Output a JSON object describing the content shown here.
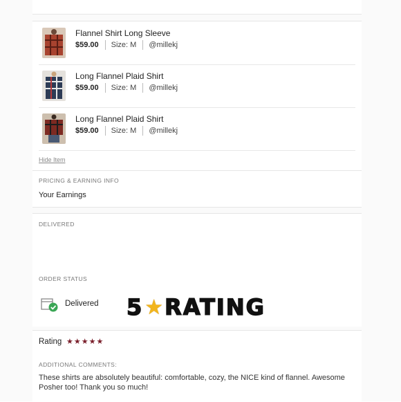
{
  "items": [
    {
      "title": "Flannel Shirt Long Sleeve",
      "price": "$59.00",
      "size": "Size: M",
      "seller": "@millekj",
      "thumb_icon": "shirt-photo"
    },
    {
      "title": "Long Flannel Plaid Shirt",
      "price": "$59.00",
      "size": "Size: M",
      "seller": "@millekj",
      "thumb_icon": "shirt-photo"
    },
    {
      "title": "Long Flannel Plaid Shirt",
      "price": "$59.00",
      "size": "Size: M",
      "seller": "@millekj",
      "thumb_icon": "shirt-photo"
    }
  ],
  "hide_item_label": "Hide Item",
  "pricing": {
    "section_label": "PRICING & EARNING INFO",
    "earnings_label": "Your Earnings"
  },
  "delivered_section": {
    "section_label": "DELIVERED"
  },
  "order_status": {
    "section_label": "ORDER STATUS",
    "status": "Delivered",
    "icon": "package-check-icon",
    "status_color": "#3aa655"
  },
  "banner": {
    "number": "5",
    "icon": "star-emoji",
    "word": "RATING"
  },
  "rating": {
    "label": "Rating",
    "stars": "★★★★★",
    "star_count": 5,
    "star_color": "#7a1f2b"
  },
  "comments": {
    "section_label": "ADDITIONAL COMMENTS:",
    "text": "These shirts are absolutely beautiful: comfortable, cozy, the NICE kind of flannel. Awesome Posher too! Thank you so much!"
  }
}
